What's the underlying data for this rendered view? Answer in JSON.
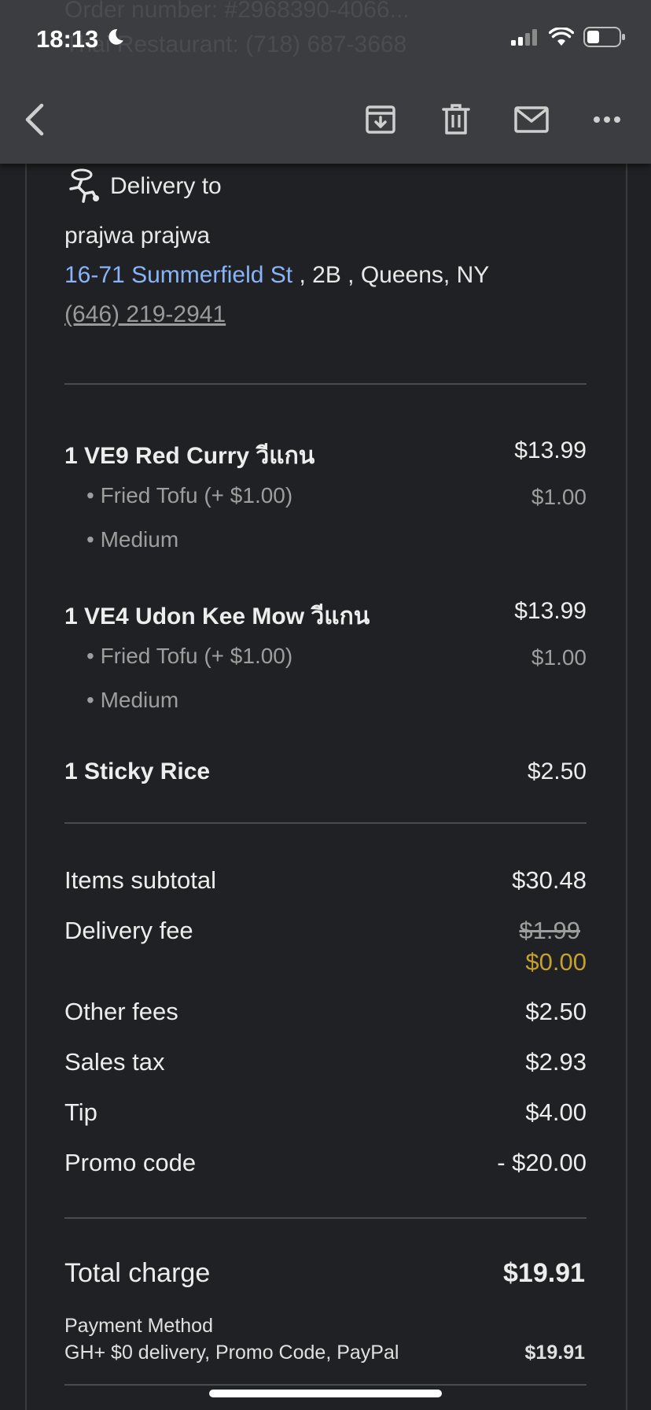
{
  "status_bar": {
    "time": "18:13",
    "moon_icon": "moon-icon",
    "signal_icon": "cellular-signal-icon",
    "wifi_icon": "wifi-icon",
    "battery_icon": "battery-icon"
  },
  "ghost_lines": [
    "Order number: #2968390-4066...",
    "Thai Restaurant: (718) 687-3668"
  ],
  "toolbar": {
    "back_icon": "back-arrow-icon",
    "archive_icon": "archive-icon",
    "delete_icon": "trash-icon",
    "mark_unread_icon": "mail-icon",
    "more_icon": "more-horizontal-icon"
  },
  "delivery": {
    "heading": "Delivery to",
    "icon": "delivery-person-icon",
    "name": "prajwa prajwa",
    "street": "16-71 Summerfield St",
    "address_rest": " , 2B , Queens, NY",
    "phone": "(646) 219-2941"
  },
  "items": [
    {
      "name": "1 VE9 Red Curry วีแกน",
      "price": "$13.99",
      "mods": [
        {
          "text": "• Fried Tofu (+ $1.00)",
          "price": "$1.00"
        },
        {
          "text": "• Medium",
          "price": ""
        }
      ]
    },
    {
      "name": "1 VE4 Udon Kee Mow วีแกน",
      "price": "$13.99",
      "mods": [
        {
          "text": "• Fried Tofu (+ $1.00)",
          "price": "$1.00"
        },
        {
          "text": "• Medium",
          "price": ""
        }
      ]
    },
    {
      "name": "1 Sticky Rice",
      "price": "$2.50",
      "mods": []
    }
  ],
  "summary": {
    "subtotal_label": "Items subtotal",
    "subtotal": "$30.48",
    "delivery_fee_label": "Delivery fee",
    "delivery_fee_original": "$1.99",
    "delivery_fee": "$0.00",
    "other_fees_label": "Other fees",
    "other_fees": "$2.50",
    "sales_tax_label": "Sales tax",
    "sales_tax": "$2.93",
    "tip_label": "Tip",
    "tip": "$4.00",
    "promo_label": "Promo code",
    "promo": "- $20.00"
  },
  "total": {
    "label": "Total charge",
    "value": "$19.91",
    "payment_method_label": "Payment Method",
    "payment_method": "GH+ $0 delivery, Promo Code, PayPal",
    "payment_amount": "$19.91"
  },
  "colors": {
    "background": "#202124",
    "header": "#3c3d40",
    "link": "#8ab4f8",
    "discount": "#c5a02f"
  }
}
